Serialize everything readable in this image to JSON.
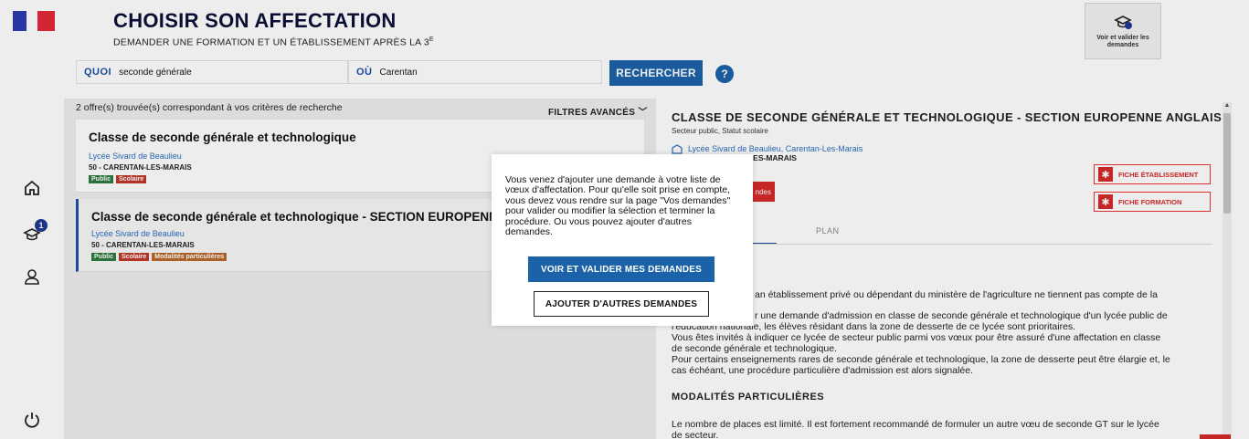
{
  "header": {
    "title": "CHOISIR SON AFFECTATION",
    "subtitle": "DEMANDER UNE FORMATION ET UN ÉTABLISSEMENT APRÈS LA 3",
    "subtitle_sup": "E",
    "cart_label": "Voir et valider les demandes",
    "cart_count": "1"
  },
  "search": {
    "quoi_label": "QUOI",
    "quoi_value": "seconde générale",
    "ou_label": "OÙ",
    "ou_value": "Carentan",
    "button": "RECHERCHER",
    "help": "?"
  },
  "sidebar": {
    "badge": "1"
  },
  "results": {
    "count_text": "2 offre(s) trouvée(s) correspondant à vos critères de recherche",
    "filters": "FILTRES AVANCÉS",
    "items": [
      {
        "title": "Classe de seconde générale et technologique",
        "school": "Lycée Sivard de Beaulieu",
        "town": "50 - CARENTAN-LES-MARAIS",
        "tags": [
          "Public",
          "Scolaire"
        ]
      },
      {
        "title": "Classe de seconde générale et technologique - SECTION EUROPENN",
        "school": "Lycée Sivard de Beaulieu",
        "town": "50 - CARENTAN-LES-MARAIS",
        "tags": [
          "Public",
          "Scolaire",
          "Modalités particulières"
        ]
      }
    ]
  },
  "detail": {
    "title": "CLASSE DE SECONDE GÉNÉRALE ET TECHNOLOGIQUE - SECTION EUROPENNE ANGLAIS",
    "sector": "Secteur public, Statut scolaire",
    "school_link": "Lycée Sivard de Beaulieu, Carentan-Les-Marais",
    "town_fragment": "N-LES-MARAIS",
    "fiche_etab": "FICHE ÉTABLISSEMENT",
    "fiche_form": "FICHE FORMATION",
    "red_btn_fragment": "ndes",
    "tab_fragment": "S",
    "tab_plan": "PLAN",
    "line1": "an établissement privé ou dépendant du ministère de l'agriculture ne tiennent pas compte de la",
    "line2": "r une demande d'admission en classe de seconde générale et technologique d'un lycée public de",
    "line3": "l'éducation nationale, les élèves résidant dans la zone de desserte de ce lycée sont prioritaires.",
    "line4": "Vous êtes invités à indiquer ce lycée de secteur public parmi vos vœux pour être assuré d'une affectation en classe",
    "line5": "de seconde générale et technologique.",
    "line6": "Pour certains enseignements rares de seconde générale et technologique, la zone de desserte peut être élargie et, le",
    "line7": "cas échéant, une procédure particulière d'admission est alors signalée.",
    "section_head": "MODALITÉS PARTICULIÈRES",
    "line8": "Le nombre de places est limité. Il est fortement recommandé de formuler un autre vœu de seconde GT sur le lycée",
    "line9": "de secteur."
  },
  "modal": {
    "message": "Vous venez d'ajouter une demande à votre liste de vœux d'affectation. Pour qu'elle soit prise en compte, vous devez vous rendre sur la page \"Vos demandes\" pour valider ou modifier la sélection et terminer la procédure. Ou vous pouvez ajouter d'autres demandes.",
    "primary": "VOIR ET VALIDER MES DEMANDES",
    "secondary": "AJOUTER D'AUTRES DEMANDES"
  },
  "colors": {
    "accent": "#1b62a8",
    "navy": "#1f3a93",
    "red": "#d42a2a",
    "green": "#2f7a3f"
  }
}
